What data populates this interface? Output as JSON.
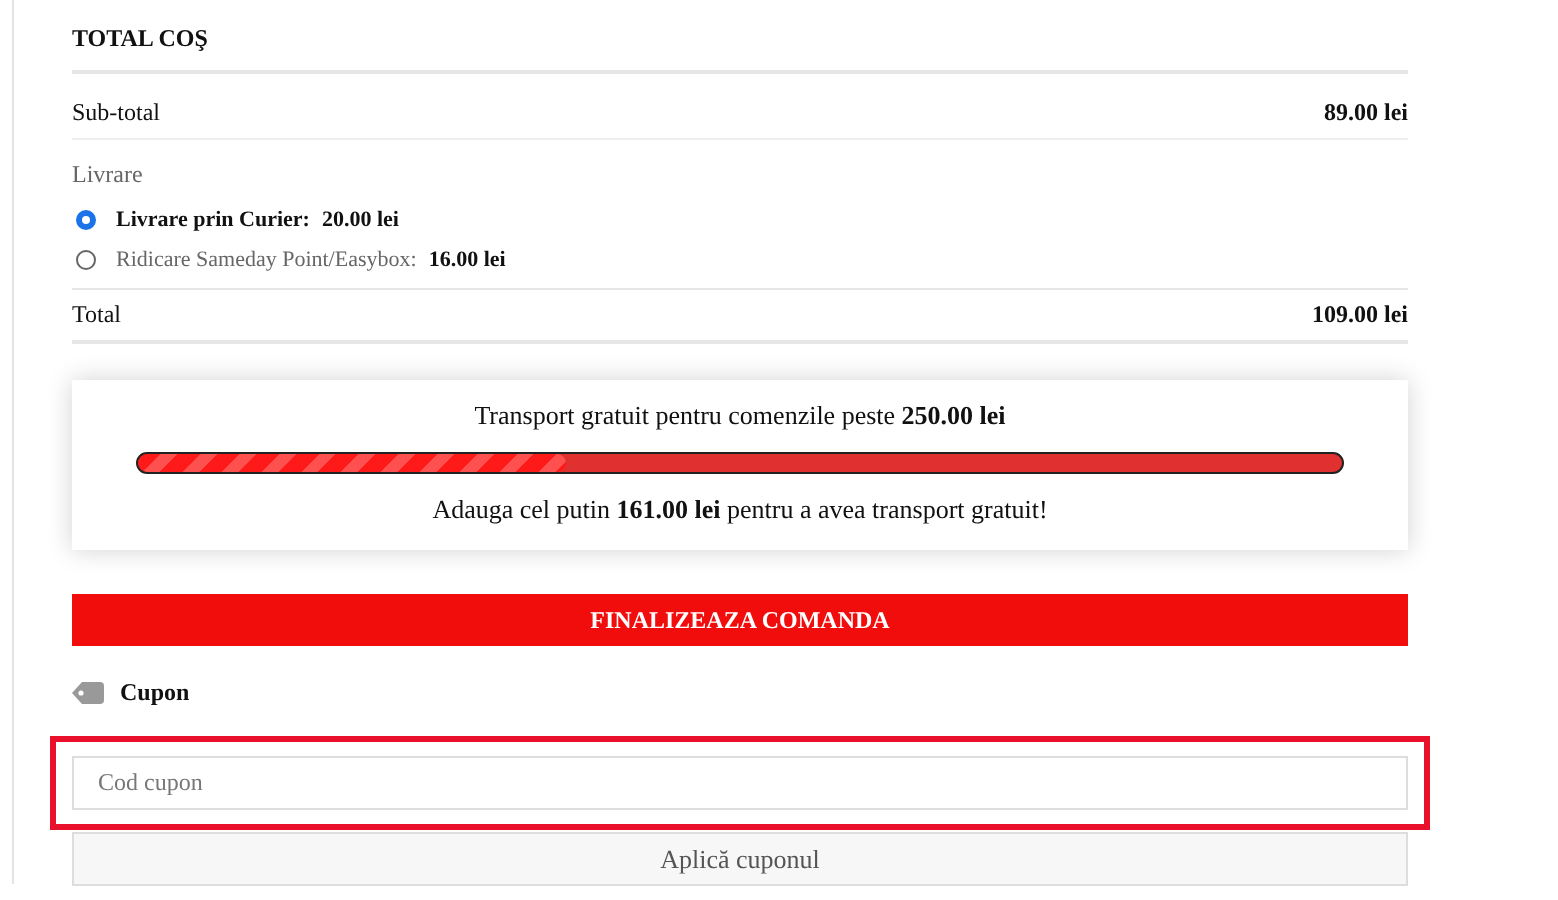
{
  "title": "TOTAL COŞ",
  "subtotal": {
    "label": "Sub-total",
    "value": "89.00 lei"
  },
  "shipping": {
    "label": "Livrare",
    "options": [
      {
        "label": "Livrare prin Curier:",
        "price": "20.00 lei",
        "selected": true
      },
      {
        "label": "Ridicare Sameday Point/Easybox:",
        "price": "16.00 lei",
        "selected": false
      }
    ]
  },
  "total": {
    "label": "Total",
    "value": "109.00 lei"
  },
  "free_shipping": {
    "heading": "Transport gratuit pentru comenzile peste **250.00 lei**",
    "level": 0.356,
    "message": "Adauga cel putin **161.00 lei** pentru a avea transport gratuit!"
  },
  "checkout_button": "FINALIZEAZA COMANDA",
  "coupon": {
    "label": "Cupon",
    "placeholder": "Cod cupon",
    "highlighted": true,
    "button": "Aplică cuponul"
  }
}
